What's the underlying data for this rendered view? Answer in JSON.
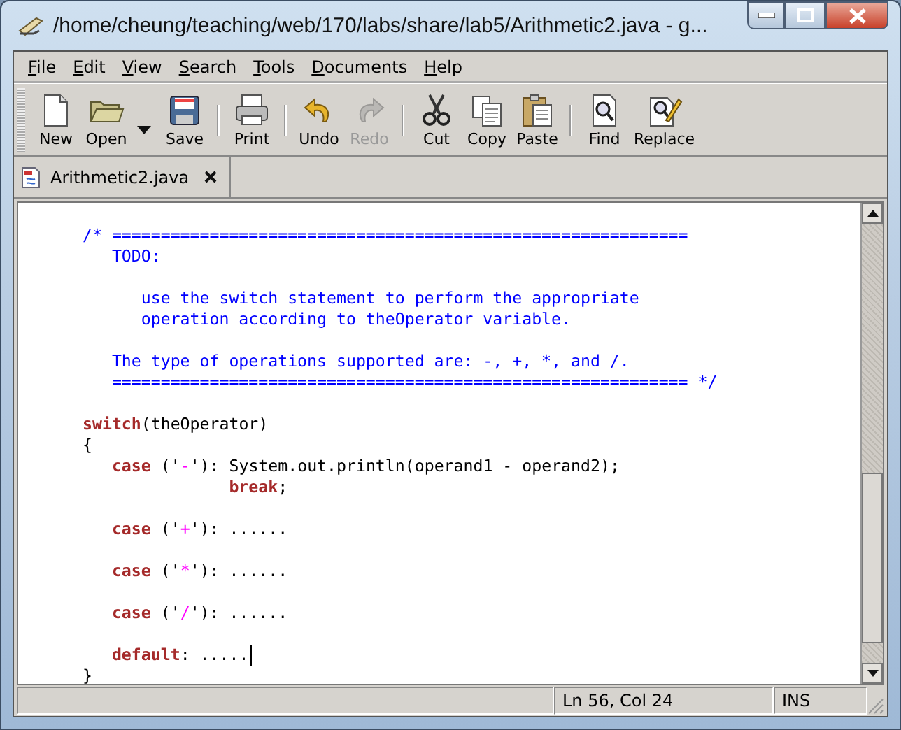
{
  "window": {
    "title": "/home/cheung/teaching/web/170/labs/share/lab5/Arithmetic2.java - g..."
  },
  "menu": [
    {
      "label": "File"
    },
    {
      "label": "Edit"
    },
    {
      "label": "View"
    },
    {
      "label": "Search"
    },
    {
      "label": "Tools"
    },
    {
      "label": "Documents"
    },
    {
      "label": "Help"
    }
  ],
  "toolbar": [
    {
      "kind": "button",
      "label": "New",
      "disabled": false
    },
    {
      "kind": "button",
      "label": "Open",
      "disabled": false
    },
    {
      "kind": "dropdown"
    },
    {
      "kind": "button",
      "label": "Save",
      "disabled": false
    },
    {
      "kind": "separator"
    },
    {
      "kind": "button",
      "label": "Print",
      "disabled": false
    },
    {
      "kind": "separator"
    },
    {
      "kind": "button",
      "label": "Undo",
      "disabled": false
    },
    {
      "kind": "button",
      "label": "Redo",
      "disabled": true
    },
    {
      "kind": "separator"
    },
    {
      "kind": "button",
      "label": "Cut",
      "disabled": false
    },
    {
      "kind": "button",
      "label": "Copy",
      "disabled": false
    },
    {
      "kind": "button",
      "label": "Paste",
      "disabled": false
    },
    {
      "kind": "separator"
    },
    {
      "kind": "button",
      "label": "Find",
      "disabled": false
    },
    {
      "kind": "button",
      "label": "Replace",
      "disabled": false
    }
  ],
  "tabs": [
    {
      "label": "Arithmetic2.java",
      "selected": true
    }
  ],
  "code_lines": [
    {
      "kind": "code",
      "segments": [
        {
          "kind": "comment",
          "text": "/* ==========================================================="
        }
      ]
    },
    {
      "kind": "code",
      "segments": [
        {
          "kind": "comment",
          "text": "   TODO:"
        }
      ]
    },
    {
      "kind": "blank"
    },
    {
      "kind": "code",
      "segments": [
        {
          "kind": "comment",
          "text": "      use the switch statement to perform the appropriate"
        }
      ]
    },
    {
      "kind": "code",
      "segments": [
        {
          "kind": "comment",
          "text": "      operation according to theOperator variable."
        }
      ]
    },
    {
      "kind": "blank"
    },
    {
      "kind": "code",
      "segments": [
        {
          "kind": "comment",
          "text": "   The type of operations supported are: -, +, *, and /."
        }
      ]
    },
    {
      "kind": "code",
      "segments": [
        {
          "kind": "comment",
          "text": "   =========================================================== */"
        }
      ]
    },
    {
      "kind": "blank"
    },
    {
      "kind": "code",
      "segments": [
        {
          "kind": "keyword",
          "text": "switch"
        },
        {
          "kind": "plain",
          "text": "(theOperator)"
        }
      ]
    },
    {
      "kind": "code",
      "segments": [
        {
          "kind": "plain",
          "text": "{"
        }
      ]
    },
    {
      "kind": "code",
      "segments": [
        {
          "kind": "keyword",
          "text": "   case"
        },
        {
          "kind": "plain",
          "text": " ('"
        },
        {
          "kind": "char",
          "text": "-"
        },
        {
          "kind": "plain",
          "text": "'): System.out.println(operand1 - operand2);"
        }
      ]
    },
    {
      "kind": "code",
      "segments": [
        {
          "kind": "keyword",
          "text": "               break"
        },
        {
          "kind": "plain",
          "text": ";"
        }
      ]
    },
    {
      "kind": "blank"
    },
    {
      "kind": "code",
      "segments": [
        {
          "kind": "keyword",
          "text": "   case"
        },
        {
          "kind": "plain",
          "text": " ('"
        },
        {
          "kind": "char",
          "text": "+"
        },
        {
          "kind": "plain",
          "text": "'): ......"
        }
      ]
    },
    {
      "kind": "blank"
    },
    {
      "kind": "code",
      "segments": [
        {
          "kind": "keyword",
          "text": "   case"
        },
        {
          "kind": "plain",
          "text": " ('"
        },
        {
          "kind": "char",
          "text": "*"
        },
        {
          "kind": "plain",
          "text": "'): ......"
        }
      ]
    },
    {
      "kind": "blank"
    },
    {
      "kind": "code",
      "segments": [
        {
          "kind": "keyword",
          "text": "   case"
        },
        {
          "kind": "plain",
          "text": " ('"
        },
        {
          "kind": "char",
          "text": "/"
        },
        {
          "kind": "plain",
          "text": "'): ......"
        }
      ]
    },
    {
      "kind": "blank"
    },
    {
      "kind": "code",
      "cursor": true,
      "segments": [
        {
          "kind": "keyword",
          "text": "   default"
        },
        {
          "kind": "plain",
          "text": ": ....."
        }
      ]
    },
    {
      "kind": "code",
      "segments": [
        {
          "kind": "plain",
          "text": "}"
        }
      ]
    }
  ],
  "status_bar": {
    "position": "Ln 56, Col 24",
    "mode": "INS"
  }
}
